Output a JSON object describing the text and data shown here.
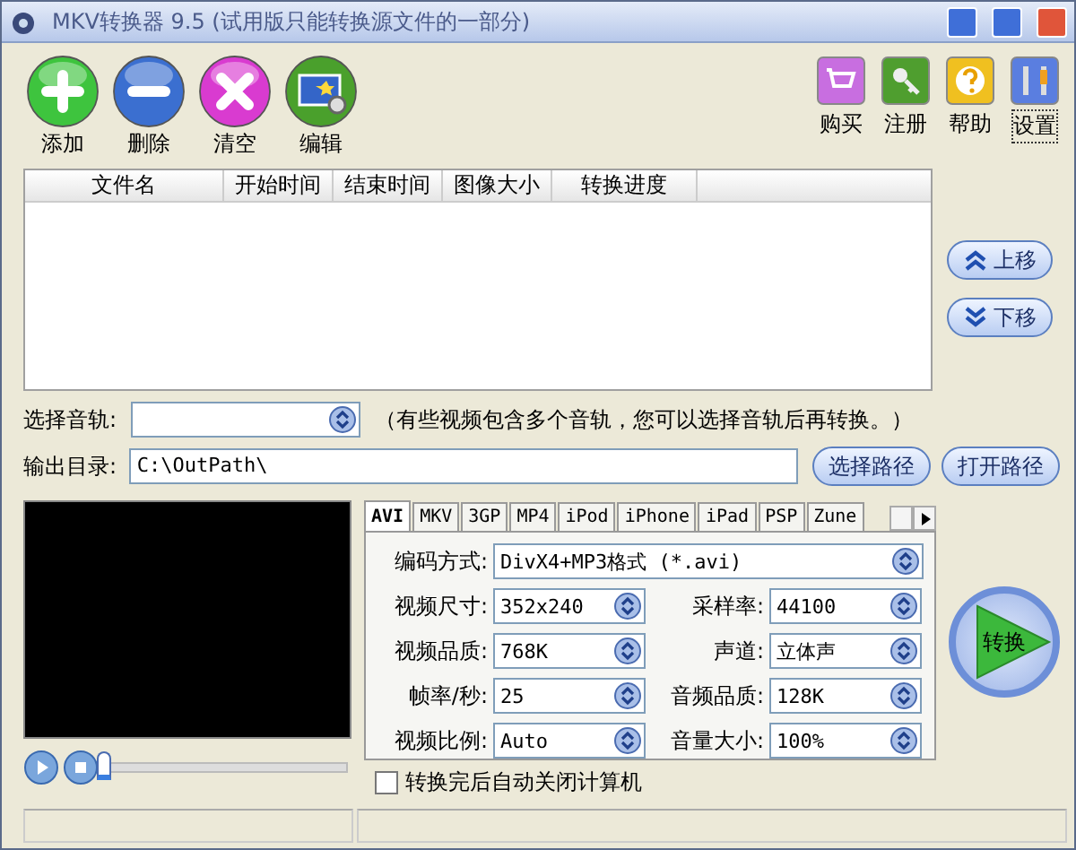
{
  "window": {
    "title": "MKV转换器 9.5 (试用版只能转换源文件的一部分)"
  },
  "toolbar": [
    {
      "label": "添加",
      "kind": "add"
    },
    {
      "label": "删除",
      "kind": "remove"
    },
    {
      "label": "清空",
      "kind": "clear"
    },
    {
      "label": "编辑",
      "kind": "edit"
    }
  ],
  "top_right": [
    {
      "label": "购买",
      "kind": "buy",
      "focused": false
    },
    {
      "label": "注册",
      "kind": "register",
      "focused": false
    },
    {
      "label": "帮助",
      "kind": "help",
      "focused": false
    },
    {
      "label": "设置",
      "kind": "settings",
      "focused": true
    }
  ],
  "file_list": {
    "columns": [
      "文件名",
      "开始时间",
      "结束时间",
      "图像大小",
      "转换进度"
    ]
  },
  "move_buttons": [
    {
      "label": "上移",
      "kind": "up"
    },
    {
      "label": "下移",
      "kind": "down"
    }
  ],
  "audio_track": {
    "label": "选择音轨:",
    "note": "（有些视频包含多个音轨，您可以选择音轨后再转换。）"
  },
  "output": {
    "label": "输出目录:",
    "value": "C:\\OutPath\\",
    "buttons": [
      "选择路径",
      "打开路径"
    ]
  },
  "player": {
    "level": 0
  },
  "format_tabs": [
    {
      "label": "AVI",
      "selected": true
    },
    {
      "label": "MKV",
      "selected": false
    },
    {
      "label": "3GP",
      "selected": false
    },
    {
      "label": "MP4",
      "selected": false
    },
    {
      "label": "iPod",
      "selected": false
    },
    {
      "label": "iPhone",
      "selected": false
    },
    {
      "label": "iPad",
      "selected": false
    },
    {
      "label": "PSP",
      "selected": false
    },
    {
      "label": "Zune",
      "selected": false
    }
  ],
  "encoding": {
    "label": "编码方式:",
    "value": "DivX4+MP3格式 (*.avi)"
  },
  "fields": [
    {
      "label": "视频尺寸:",
      "value": "352x240"
    },
    {
      "label": "采样率:",
      "value": "44100"
    },
    {
      "label": "视频品质:",
      "value": "768K"
    },
    {
      "label": "声道:",
      "value": "立体声"
    },
    {
      "label": "帧率/秒:",
      "value": "25"
    },
    {
      "label": "音频品质:",
      "value": "128K"
    },
    {
      "label": "视频比例:",
      "value": "Auto"
    },
    {
      "label": "音量大小:",
      "value": "100%"
    }
  ],
  "auto_shutdown": {
    "label": "转换完后自动关闭计算机",
    "checked": false
  },
  "convert_button": "转换"
}
